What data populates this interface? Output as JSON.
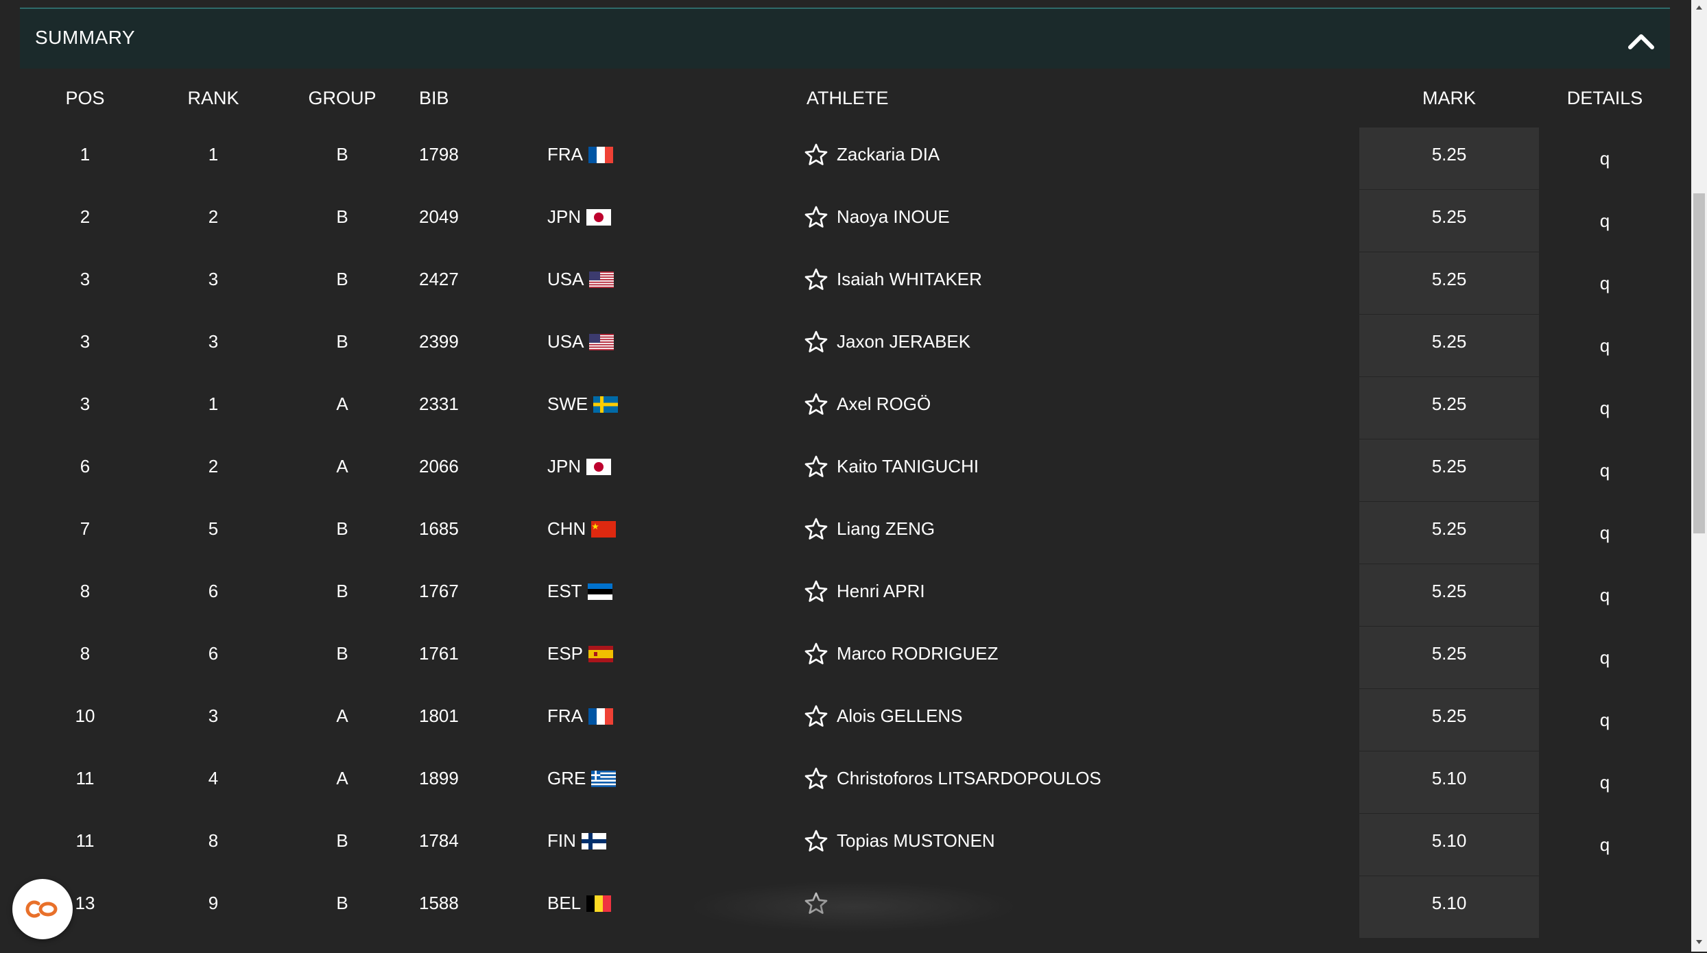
{
  "summary": {
    "title": "SUMMARY"
  },
  "columns": {
    "pos": "POS",
    "rank": "RANK",
    "group": "GROUP",
    "bib": "BIB",
    "athlete": "ATHLETE",
    "mark": "MARK",
    "details": "DETAILS"
  },
  "rows": [
    {
      "pos": "1",
      "rank": "1",
      "group": "B",
      "bib": "1798",
      "country": "FRA",
      "flag": "FRA",
      "athlete": "Zackaria DIA",
      "mark": "5.25",
      "details": "q"
    },
    {
      "pos": "2",
      "rank": "2",
      "group": "B",
      "bib": "2049",
      "country": "JPN",
      "flag": "JPN",
      "athlete": "Naoya INOUE",
      "mark": "5.25",
      "details": "q"
    },
    {
      "pos": "3",
      "rank": "3",
      "group": "B",
      "bib": "2427",
      "country": "USA",
      "flag": "USA",
      "athlete": "Isaiah WHITAKER",
      "mark": "5.25",
      "details": "q"
    },
    {
      "pos": "3",
      "rank": "3",
      "group": "B",
      "bib": "2399",
      "country": "USA",
      "flag": "USA",
      "athlete": "Jaxon JERABEK",
      "mark": "5.25",
      "details": "q"
    },
    {
      "pos": "3",
      "rank": "1",
      "group": "A",
      "bib": "2331",
      "country": "SWE",
      "flag": "SWE",
      "athlete": "Axel ROGÖ",
      "mark": "5.25",
      "details": "q"
    },
    {
      "pos": "6",
      "rank": "2",
      "group": "A",
      "bib": "2066",
      "country": "JPN",
      "flag": "JPN",
      "athlete": "Kaito TANIGUCHI",
      "mark": "5.25",
      "details": "q"
    },
    {
      "pos": "7",
      "rank": "5",
      "group": "B",
      "bib": "1685",
      "country": "CHN",
      "flag": "CHN",
      "athlete": "Liang ZENG",
      "mark": "5.25",
      "details": "q"
    },
    {
      "pos": "8",
      "rank": "6",
      "group": "B",
      "bib": "1767",
      "country": "EST",
      "flag": "EST",
      "athlete": "Henri APRI",
      "mark": "5.25",
      "details": "q"
    },
    {
      "pos": "8",
      "rank": "6",
      "group": "B",
      "bib": "1761",
      "country": "ESP",
      "flag": "ESP",
      "athlete": "Marco RODRIGUEZ",
      "mark": "5.25",
      "details": "q"
    },
    {
      "pos": "10",
      "rank": "3",
      "group": "A",
      "bib": "1801",
      "country": "FRA",
      "flag": "FRA",
      "athlete": "Alois GELLENS",
      "mark": "5.25",
      "details": "q"
    },
    {
      "pos": "11",
      "rank": "4",
      "group": "A",
      "bib": "1899",
      "country": "GRE",
      "flag": "GRE",
      "athlete": "Christoforos LITSARDOPOULOS",
      "mark": "5.10",
      "details": "q"
    },
    {
      "pos": "11",
      "rank": "8",
      "group": "B",
      "bib": "1784",
      "country": "FIN",
      "flag": "FIN",
      "athlete": "Topias MUSTONEN",
      "mark": "5.10",
      "details": "q"
    },
    {
      "pos": "13",
      "rank": "9",
      "group": "B",
      "bib": "1588",
      "country": "BEL",
      "flag": "BEL",
      "athlete": "",
      "mark": "5.10",
      "details": ""
    }
  ],
  "colors": {
    "background": "#252525",
    "summary_bar": "#1b2a2b",
    "mark_cell": "#333333",
    "accent": "#2f6b6a",
    "chat_icon": "#e8702a"
  },
  "icons": {
    "collapse": "chevron-up-icon",
    "favorite": "star-outline-icon",
    "chat": "chat-logo-icon"
  }
}
